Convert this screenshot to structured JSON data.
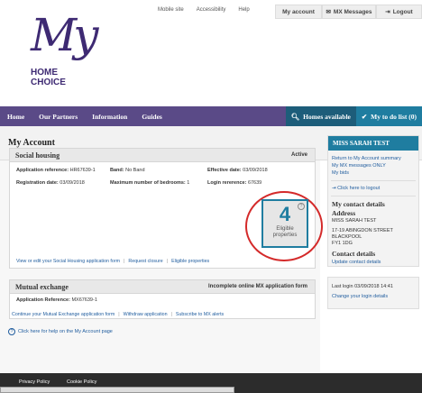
{
  "brand": {
    "my": "My",
    "home": "HOME",
    "choice": "CHOICE"
  },
  "toplinks": [
    "Mobile site",
    "Accessibility",
    "Help"
  ],
  "top_tabs": {
    "account": "My account",
    "messages": "MX Messages",
    "logout": "Logout"
  },
  "nav": {
    "items": [
      "Home",
      "Our Partners",
      "Information",
      "Guides"
    ],
    "homes_available": "Homes available",
    "todo": "My to do list (0)"
  },
  "page_title": "My Account",
  "social": {
    "title": "Social housing",
    "status": "Active",
    "app_ref_label": "Application reference:",
    "app_ref": "HR67639-1",
    "band_label": "Band:",
    "band": "No Band",
    "eff_label": "Effective date:",
    "eff_date": "03/09/2018",
    "reg_label": "Registration date:",
    "reg_date": "03/09/2018",
    "bed_label": "Maximum number of bedrooms:",
    "bedrooms": "1",
    "login_ref_label": "Login rererence:",
    "login_ref": "67639",
    "eligible_count": "4",
    "eligible_line1": "Eligible",
    "eligible_line2": "properties",
    "links": [
      "View or edit your Social Housing application form",
      "Request closure",
      "Eligible properties"
    ]
  },
  "mutual": {
    "title": "Mutual exchange",
    "status": "Incomplete online MX application form",
    "ref_label": "Application Reference:",
    "ref": "MX67639-1",
    "links": [
      "Continue your Mutual Exchange application form",
      "Withdraw application",
      "Subscribe to MX alerts"
    ]
  },
  "help_text": "Click here for help on the My Account page",
  "sidebar": {
    "name": "MISS SARAH TEST",
    "links": [
      "Return to My Account summary",
      "My MX messages ONLY",
      "My bids"
    ],
    "logout": "Click here to logout",
    "contact_heading": "My contact details",
    "address_heading": "Address",
    "address": [
      "MISS SARAH TEST",
      "17-19 ABINGDON STREET",
      "BLACKPOOL",
      "FY1 1DG"
    ],
    "contact_details_heading": "Contact details",
    "update_contact": "Update contact details",
    "last_login": "Last login 03/09/2018 14:41",
    "change_login": "Change your login details"
  },
  "footer": {
    "privacy": "Privacy Policy",
    "cookie": "Cookie Policy"
  },
  "colors": {
    "purple": "#5a4a87",
    "teal": "#1f7da0",
    "red": "#d42a2a"
  }
}
